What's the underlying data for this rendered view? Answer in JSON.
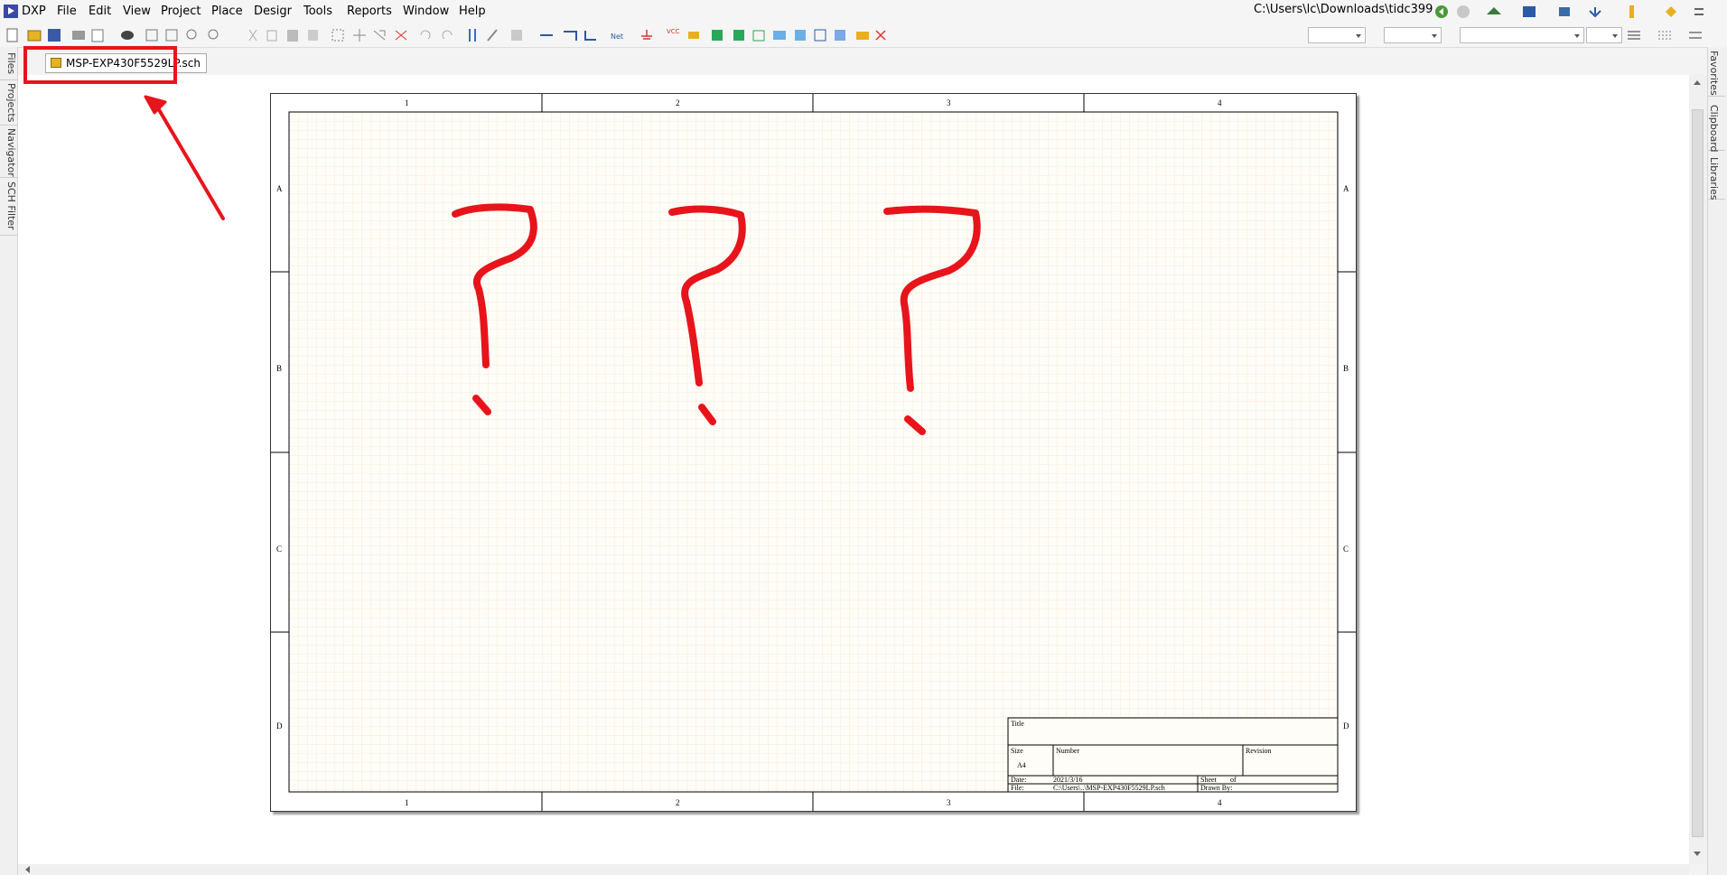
{
  "app": {
    "logo_label": "DXP"
  },
  "menu": {
    "items": [
      "DXP",
      "File",
      "Edit",
      "View",
      "Project",
      "Place",
      "Desigr",
      "Tools",
      "Reports",
      "Window",
      "Help"
    ]
  },
  "toolbar": {
    "path": "C:\\Users\\lc\\Downloads\\tidc399",
    "icons": [
      "new-icon",
      "open-icon",
      "save-icon",
      "print-icon",
      "print-preview-icon",
      "layers-icon",
      "zoom-fit-icon",
      "zoom-area-icon",
      "zoom-selected-icon",
      "zoom-dropdown-icon",
      "cut-icon",
      "copy-icon",
      "paste-icon",
      "rubber-stamp-icon",
      "select-area-icon",
      "move-icon",
      "select-icon",
      "clear-icon",
      "undo-icon",
      "redo-icon",
      "cross-probe-icon",
      "pencil-icon",
      "browse-library-icon",
      "wire-icon",
      "bus-icon",
      "bus-entry-icon",
      "net-label-icon",
      "gnd-port-icon",
      "vcc-port-icon",
      "place-part-icon",
      "sheet-symbol-icon",
      "sheet-entry-icon",
      "device-sheet-icon",
      "port-icon",
      "no-erc-icon",
      "directive-icon",
      "hierarchy-icon",
      "compile-icon",
      "no-connect-icon"
    ],
    "net_label_text": "Net",
    "vcc_label_text": "VCC"
  },
  "side_tabs": {
    "left": [
      "Files",
      "Projects",
      "Navigator",
      "SCH Filter"
    ],
    "right": [
      "Favorites",
      "Clipboard",
      "Libraries"
    ]
  },
  "document": {
    "tab_label": "MSP-EXP430F5529LP.sch",
    "file_icon": "schematic-file-icon"
  },
  "sheet": {
    "columns": [
      "1",
      "2",
      "3",
      "4"
    ],
    "rows": [
      "A",
      "B",
      "C",
      "D"
    ],
    "title_block": {
      "title_label": "Title",
      "size_label": "Size",
      "size_value": "A4",
      "number_label": "Number",
      "revision_label": "Revision",
      "date_label": "Date:",
      "date_value": "2021/3/16",
      "sheet_label": "Sheet",
      "of_label": "of",
      "file_label": "File:",
      "file_value": "C:\\Users\\..\\MSP-EXP430F5529LP.sch",
      "drawn_label": "Drawn By:"
    }
  },
  "annotation": {
    "marks": [
      "?",
      "?",
      "?"
    ],
    "color": "#e8141b"
  },
  "colors": {
    "grid": "#f3ead9",
    "accent": "#e8141b",
    "sheet_bg": "#fffdf8"
  }
}
